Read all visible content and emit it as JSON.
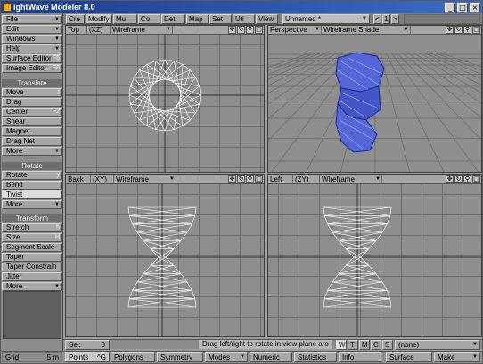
{
  "app": {
    "title": "ightWave Modeler 8.0",
    "min": "_",
    "max": "□",
    "close": "×"
  },
  "tabs": [
    "Cre",
    "Modify",
    "Mu",
    "Co",
    "Det",
    "Map",
    "Set",
    "Uti",
    "View"
  ],
  "layer_name": "Unnamed *",
  "layer_nums": [
    "<",
    "1",
    ">"
  ],
  "menus": {
    "file": "File",
    "edit": "Edit",
    "windows": "Windows",
    "help": "Help",
    "surface_editor": "Surface Editor",
    "surface_key": "F5",
    "image_editor": "Image Editor",
    "image_key": "F6"
  },
  "translate": {
    "header": "Translate",
    "items": [
      {
        "label": "Move",
        "key": "t"
      },
      {
        "label": "Drag",
        "key": ""
      },
      {
        "label": "Center",
        "key": "F2"
      },
      {
        "label": "Shear",
        "key": ""
      },
      {
        "label": "Magnet",
        "key": ""
      },
      {
        "label": "Drag Net",
        "key": ""
      },
      {
        "label": "More",
        "key": ""
      }
    ]
  },
  "rotate": {
    "header": "Rotate",
    "items": [
      {
        "label": "Rotate",
        "key": "y"
      },
      {
        "label": "Bend",
        "key": ""
      },
      {
        "label": "Twist",
        "key": ""
      },
      {
        "label": "More",
        "key": ""
      }
    ]
  },
  "transform": {
    "header": "Transform",
    "items": [
      {
        "label": "Stretch",
        "key": "h"
      },
      {
        "label": "Size",
        "key": "H"
      },
      {
        "label": "Segment Scale",
        "key": ""
      },
      {
        "label": "Taper",
        "key": ""
      },
      {
        "label": "Taper Constrain",
        "key": ""
      },
      {
        "label": "Jitter",
        "key": ""
      },
      {
        "label": "More",
        "key": ""
      }
    ]
  },
  "viewports": {
    "tl": {
      "view": "Top",
      "axis": "(XZ)",
      "mode": "Wireframe"
    },
    "tr": {
      "view": "Perspective",
      "mode": "Wireframe Shade"
    },
    "bl": {
      "view": "Back",
      "axis": "(XY)",
      "mode": "Wireframe"
    },
    "br": {
      "view": "Left",
      "axis": "(ZY)",
      "mode": "Wireframe"
    }
  },
  "status": {
    "sel_label": "Sel:",
    "sel_value": "0",
    "hint": "Drag left/right to rotate in view plane aro",
    "wtmcs": [
      "W",
      "T",
      "M",
      "C",
      "S"
    ],
    "layer_dropdown": "(none)"
  },
  "grid": {
    "label": "Grid",
    "value": "5 m"
  },
  "bottom": {
    "points": "Points",
    "points_key": "^G",
    "polygons": "Polygons",
    "symmetry": "Symmetry",
    "modes": "Modes",
    "numeric": "Numeric",
    "statistics": "Statistics",
    "info": "Info",
    "surface": "Surface",
    "make": "Make"
  },
  "colors": {
    "wire": "#ffffff",
    "shade": "#4a5ad0",
    "grid": "#6a6a6a"
  }
}
